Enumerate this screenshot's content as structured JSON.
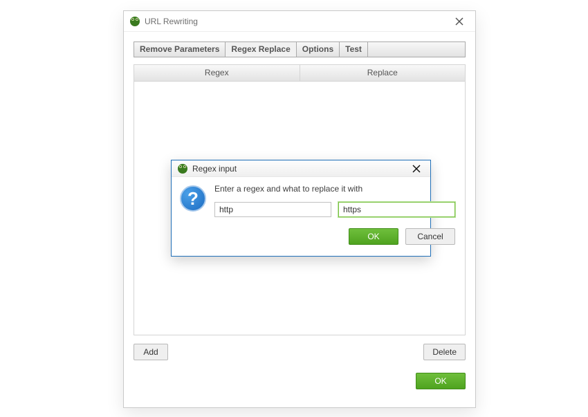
{
  "window": {
    "title": "URL Rewriting",
    "tabs": [
      {
        "label": "Remove Parameters",
        "active": false
      },
      {
        "label": "Regex Replace",
        "active": true
      },
      {
        "label": "Options",
        "active": false
      },
      {
        "label": "Test",
        "active": false
      }
    ],
    "columns": [
      "Regex",
      "Replace"
    ],
    "rows": [],
    "buttons": {
      "add": "Add",
      "delete": "Delete",
      "ok": "OK"
    }
  },
  "modal": {
    "title": "Regex input",
    "prompt": "Enter a regex and what to replace it with",
    "regex_value": "http",
    "replace_value": "https",
    "ok": "OK",
    "cancel": "Cancel"
  }
}
